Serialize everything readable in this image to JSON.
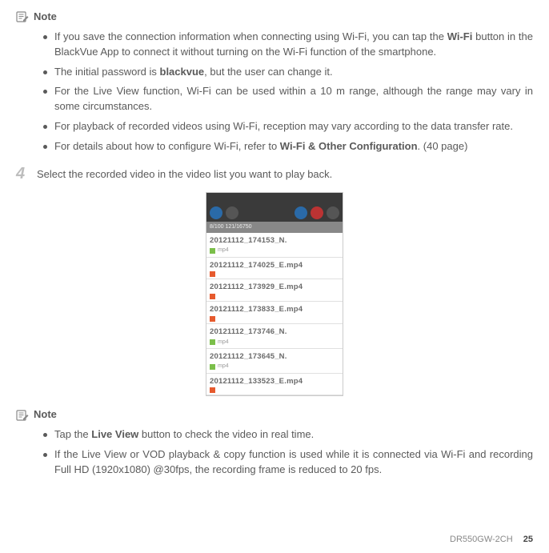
{
  "note1": {
    "title": "Note",
    "items": [
      "If you save the connection information when connecting using Wi-Fi, you can tap the <b>Wi-Fi</b> button in the BlackVue App to connect it without turning on the Wi-Fi function of the smartphone.",
      "The initial password is <b>blackvue</b>, but the user can change it.",
      "For the Live View function, Wi-Fi can be used within a 10 m range, although the range may vary in some circumstances.",
      "For playback of recorded videos using Wi-Fi, reception may vary according to the data transfer rate.",
      "For details about how to configure Wi-Fi, refer to <b>Wi-Fi & Other Configuration</b>. (40 page)"
    ]
  },
  "step": {
    "num": "4",
    "text": "Select the recorded video in the video list you want to play back."
  },
  "screenshot": {
    "subbar": "8/100 121/16750",
    "rows": [
      {
        "name": "20121112_174153_N.",
        "type": "n",
        "meta": "mp4"
      },
      {
        "name": "20121112_174025_E.mp4",
        "type": "e",
        "meta": ""
      },
      {
        "name": "20121112_173929_E.mp4",
        "type": "e",
        "meta": ""
      },
      {
        "name": "20121112_173833_E.mp4",
        "type": "e",
        "meta": ""
      },
      {
        "name": "20121112_173746_N.",
        "type": "n",
        "meta": "mp4"
      },
      {
        "name": "20121112_173645_N.",
        "type": "n",
        "meta": "mp4"
      },
      {
        "name": "20121112_133523_E.mp4",
        "type": "e",
        "meta": ""
      }
    ]
  },
  "note2": {
    "title": "Note",
    "items": [
      "Tap the <b>Live View</b> button to check the video in real time.",
      "If the Live View or VOD playback & copy function is used while it is connected via Wi-Fi and recording Full HD (1920x1080) @30fps, the recording frame is reduced to 20 fps."
    ]
  },
  "footer": {
    "model": "DR550GW-2CH",
    "page": "25"
  }
}
